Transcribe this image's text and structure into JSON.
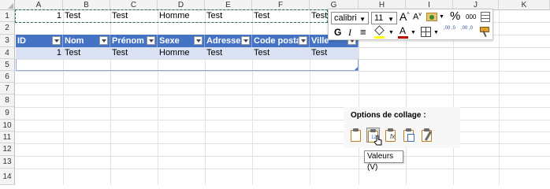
{
  "columns": [
    "A",
    "B",
    "C",
    "D",
    "E",
    "F",
    "G",
    "H",
    "I",
    "J",
    "K"
  ],
  "rows": [
    "1",
    "2",
    "3",
    "4",
    "5",
    "6",
    "7",
    "8",
    "9",
    "10",
    "11",
    "12",
    "13",
    "14"
  ],
  "row1": {
    "a": "1",
    "b": "Test",
    "c": "Test",
    "d": "Homme",
    "e": "Test",
    "f": "Test",
    "g": "Test"
  },
  "table_header": [
    "ID",
    "Nom",
    "Prénom",
    "Sexe",
    "Adresse",
    "Code postal",
    "Ville"
  ],
  "row4": {
    "a": "1",
    "b": "Test",
    "c": "Test",
    "d": "Homme",
    "e": "Test",
    "f": "Test",
    "g": "Test"
  },
  "toolbar": {
    "font_name": "calibri",
    "font_size": "11",
    "grow_label": "A",
    "shrink_label": "A",
    "percent": "%",
    "thousands": "000",
    "bold": "G",
    "italic": "I",
    "align": "≡",
    "font_color_label": "A",
    "dec_more": ",00 ,0",
    "dec_less": ",00 ,0"
  },
  "paste": {
    "title": "Options de collage :",
    "tooltip": "Valeurs (V)"
  },
  "colors": {
    "table_header": "#4472c4",
    "table_row": "#d9e1f2",
    "copy_border": "#217346",
    "font_color_bar": "#c00000",
    "fill_color_bar": "#ffff00"
  }
}
